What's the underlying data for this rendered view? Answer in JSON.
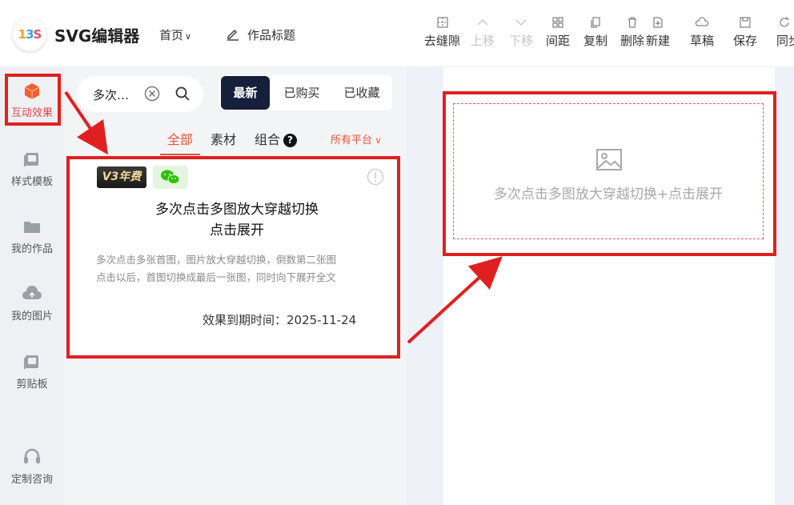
{
  "header": {
    "app_title": "SVG编辑器",
    "logo_text": [
      "1",
      "3",
      "S"
    ],
    "nav_home": "首页",
    "work_title": "作品标题"
  },
  "toolbar": [
    {
      "label": "去缝隙",
      "icon": "grid-gap-icon",
      "disabled": false
    },
    {
      "label": "上移",
      "icon": "chevron-up-icon",
      "disabled": true
    },
    {
      "label": "下移",
      "icon": "chevron-down-icon",
      "disabled": true
    },
    {
      "label": "间距",
      "icon": "spacing-icon",
      "disabled": false
    },
    {
      "label": "复制",
      "icon": "copy-icon",
      "disabled": false
    },
    {
      "label": "删除",
      "icon": "trash-icon",
      "disabled": false
    },
    {
      "label": "新建",
      "icon": "new-file-icon",
      "disabled": false
    },
    {
      "label": "草稿",
      "icon": "cloud-icon",
      "disabled": false
    },
    {
      "label": "保存",
      "icon": "save-icon",
      "disabled": false
    },
    {
      "label": "同步",
      "icon": "sync-icon",
      "disabled": false
    }
  ],
  "sidebar": {
    "items": [
      {
        "label": "互动效果",
        "icon": "cube-icon",
        "active": true
      },
      {
        "label": "样式模板",
        "icon": "template-icon",
        "active": false
      },
      {
        "label": "我的作品",
        "icon": "folder-icon",
        "active": false
      },
      {
        "label": "我的图片",
        "icon": "cloud-upload-icon",
        "active": false
      },
      {
        "label": "剪贴板",
        "icon": "clipboard-icon",
        "active": false
      },
      {
        "label": "定制咨询",
        "icon": "headset-icon",
        "active": false
      }
    ]
  },
  "panel": {
    "search": {
      "value": "多次…"
    },
    "segments": [
      {
        "label": "最新",
        "active": true
      },
      {
        "label": "已购买",
        "active": false
      },
      {
        "label": "已收藏",
        "active": false
      }
    ],
    "filters": [
      {
        "label": "全部",
        "active": true
      },
      {
        "label": "素材",
        "active": false
      },
      {
        "label": "组合",
        "active": false
      }
    ],
    "help_mark": "?",
    "platform": "所有平台",
    "card": {
      "badge": "V3年费",
      "title_line1": "多次点击多图放大穿越切换",
      "title_line2": "点击展开",
      "desc_line1": "多次点击多张首图，图片放大穿越切换，倒数第二张图",
      "desc_line2": "点击以后，首图切换成最后一张图，同时向下展开全文",
      "expire": "效果到期时间：2025-11-24"
    }
  },
  "canvas": {
    "placeholder_text": "多次点击多图放大穿越切换+点击展开"
  },
  "colors": {
    "accent": "#e8553a",
    "highlight_box": "#e02020",
    "segment_active": "#16203a"
  }
}
